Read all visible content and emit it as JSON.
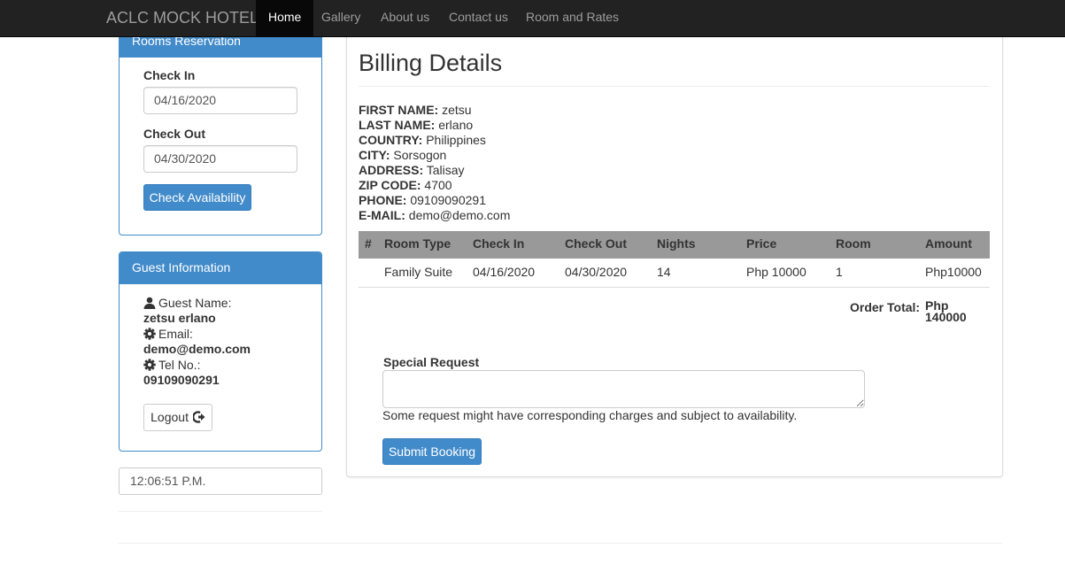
{
  "navbar": {
    "brand": "ACLC MOCK HOTEL",
    "items": [
      {
        "label": "Home",
        "active": true
      },
      {
        "label": "Gallery",
        "active": false
      },
      {
        "label": "About us",
        "active": false
      },
      {
        "label": "Contact us",
        "active": false
      },
      {
        "label": "Room and Rates",
        "active": false
      }
    ]
  },
  "reservation": {
    "heading": "Rooms Reservation",
    "check_in_label": "Check In",
    "check_in_value": "04/16/2020",
    "check_out_label": "Check Out",
    "check_out_value": "04/30/2020",
    "button": "Check Availability"
  },
  "guest": {
    "heading": "Guest Information",
    "name_label": "Guest Name:",
    "name_value": "zetsu erlano",
    "email_label": "Email:",
    "email_value": "demo@demo.com",
    "tel_label": "Tel No.:",
    "tel_value": "09109090291",
    "logout": "Logout",
    "icons": {
      "name": "user-icon",
      "email": "cog-icon",
      "tel": "cog-icon",
      "logout": "log-out-icon"
    }
  },
  "clock": "12:06:51 P.M.",
  "billing": {
    "title": "Billing Details",
    "fields": [
      {
        "key": "FIRST NAME:",
        "value": "zetsu"
      },
      {
        "key": "LAST NAME:",
        "value": "erlano"
      },
      {
        "key": "COUNTRY:",
        "value": "Philippines"
      },
      {
        "key": "CITY:",
        "value": "Sorsogon"
      },
      {
        "key": "ADDRESS:",
        "value": "Talisay"
      },
      {
        "key": "ZIP CODE:",
        "value": "4700"
      },
      {
        "key": "PHONE:",
        "value": "09109090291"
      },
      {
        "key": "E-MAIL:",
        "value": "demo@demo.com"
      }
    ]
  },
  "table": {
    "headers": [
      "#",
      "Room Type",
      "Check In",
      "Check Out",
      "Nights",
      "Price",
      "Room",
      "Amount"
    ],
    "rows": [
      [
        "",
        "Family Suite",
        "04/16/2020",
        "04/30/2020",
        "14",
        "Php 10000",
        "1",
        "Php10000"
      ]
    ],
    "total_label": "Order Total:",
    "total_value": "Php 140000"
  },
  "special_request": {
    "label": "Special Request",
    "value": "",
    "help": "Some request might have corresponding charges and subject to availability.",
    "submit": "Submit Booking"
  },
  "colors": {
    "navbar_bg": "#222222",
    "primary": "#428bca",
    "table_header": "#999999"
  }
}
